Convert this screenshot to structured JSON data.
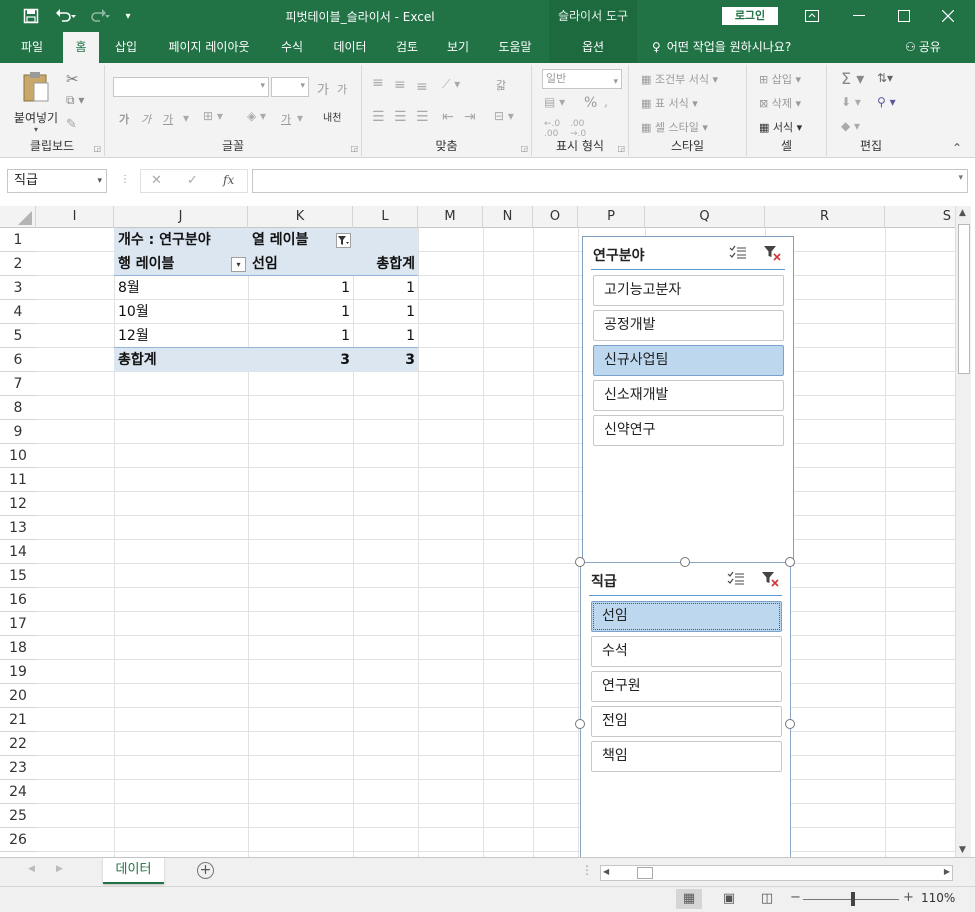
{
  "window": {
    "title": "피벗테이블_슬라이서 - Excel",
    "contextual_tab_group": "슬라이서 도구",
    "login_label": "로그인",
    "accent_color": "#217346"
  },
  "quick_access": {
    "save_icon": "save-icon",
    "undo_icon": "undo-icon",
    "redo_icon": "redo-icon"
  },
  "ribbon_tabs": [
    {
      "label": "파일"
    },
    {
      "label": "홈",
      "active": true
    },
    {
      "label": "삽입"
    },
    {
      "label": "페이지 레이아웃"
    },
    {
      "label": "수식"
    },
    {
      "label": "데이터"
    },
    {
      "label": "검토"
    },
    {
      "label": "보기"
    },
    {
      "label": "도움말"
    },
    {
      "label": "옵션"
    }
  ],
  "tell_me": "어떤 작업을 원하시나요?",
  "share_label": "공유",
  "ribbon": {
    "clipboard": {
      "paste_label": "붙여넣기",
      "group_label": "클립보드"
    },
    "font": {
      "group_label": "글꼴",
      "font_name": "",
      "font_size": "",
      "grow_label": "가",
      "shrink_label": "가",
      "bold": "가",
      "italic": "가",
      "underline": "가",
      "phonetic": "내천"
    },
    "alignment": {
      "group_label": "맞춤",
      "wrap": "갋"
    },
    "number": {
      "group_label": "표시 형식",
      "format": "일반",
      "percent": "%"
    },
    "styles": {
      "group_label": "스타일",
      "conditional": "조건부 서식",
      "table": "표 서식",
      "cell_styles": "셀 스타일"
    },
    "cells": {
      "group_label": "셀",
      "insert": "삽입",
      "delete": "삭제",
      "format": "서식"
    },
    "editing": {
      "group_label": "편집"
    }
  },
  "formula_bar": {
    "name_box": "직급",
    "fx_label": "fx",
    "formula": ""
  },
  "columns": [
    "I",
    "J",
    "K",
    "L",
    "M",
    "N",
    "O",
    "P",
    "Q",
    "R",
    "S"
  ],
  "rows": [
    "1",
    "2",
    "3",
    "4",
    "5",
    "6",
    "7",
    "8",
    "9",
    "10",
    "11",
    "12",
    "13",
    "14",
    "15",
    "16",
    "17",
    "18",
    "19",
    "20",
    "21",
    "22",
    "23",
    "24",
    "25",
    "26"
  ],
  "pivot": {
    "header_values": "개수 : 연구분야",
    "column_labels": "열 레이블",
    "row_labels": "행 레이블",
    "column_item": "선임",
    "grand_total_col": "총합계",
    "rows": [
      {
        "label": "8월",
        "value": "1",
        "total": "1"
      },
      {
        "label": "10월",
        "value": "1",
        "total": "1"
      },
      {
        "label": "12월",
        "value": "1",
        "total": "1"
      }
    ],
    "grand_total_row": {
      "label": "총합계",
      "value": "3",
      "total": "3"
    }
  },
  "slicers": [
    {
      "title": "연구분야",
      "items": [
        {
          "label": "고기능고분자",
          "selected": false
        },
        {
          "label": "공정개발",
          "selected": false
        },
        {
          "label": "신규사업팀",
          "selected": true
        },
        {
          "label": "신소재개발",
          "selected": false
        },
        {
          "label": "신약연구",
          "selected": false
        }
      ]
    },
    {
      "title": "직급",
      "items": [
        {
          "label": "선임",
          "selected": true
        },
        {
          "label": "수석",
          "selected": false
        },
        {
          "label": "연구원",
          "selected": false
        },
        {
          "label": "전임",
          "selected": false
        },
        {
          "label": "책임",
          "selected": false
        }
      ]
    }
  ],
  "sheet_tabs": [
    {
      "label": "데이터",
      "active": true
    }
  ],
  "status": {
    "zoom": "110%"
  }
}
